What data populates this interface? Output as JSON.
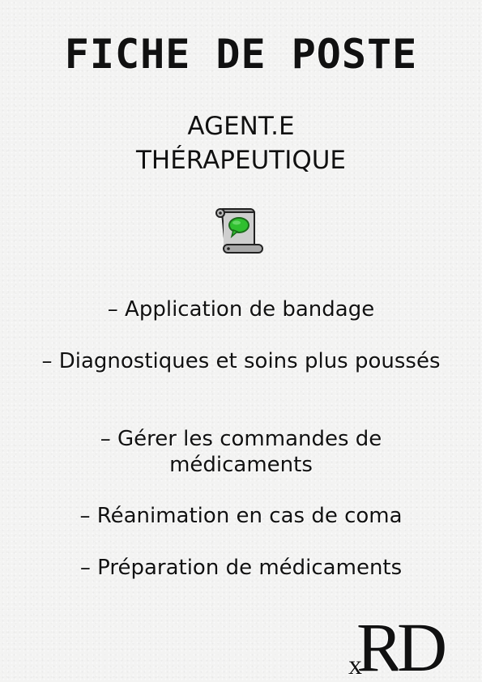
{
  "document": {
    "title": "FICHE DE POSTE",
    "subtitle_line1": "AGENT.E",
    "subtitle_line2": "THÉRAPEUTIQUE",
    "icon": "scroll-speech-bubble-icon",
    "duties": [
      "– Application de bandage",
      "– Diagnostiques et soins plus poussés",
      "– Gérer les commandes de médicaments",
      "– Réanimation en cas de coma",
      "– Préparation de médicaments"
    ],
    "logo_text": "RD",
    "logo_small": "x"
  },
  "colors": {
    "background": "#f3f3f2",
    "text": "#111111",
    "bubble_green": "#2fbf2f",
    "scroll_gray": "#b9b9b9"
  }
}
